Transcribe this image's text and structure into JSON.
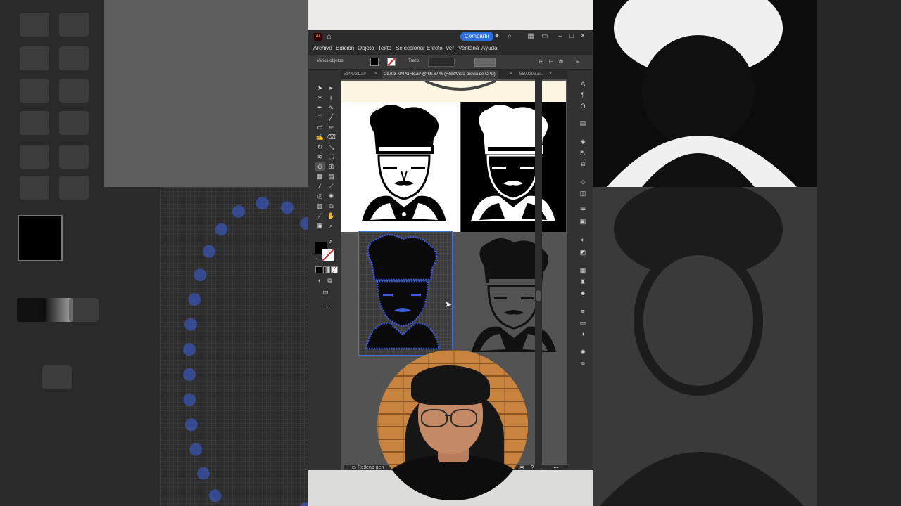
{
  "app": {
    "share_label": "Compartir",
    "logo_text": "Ai"
  },
  "menu": {
    "items": [
      "Archivo",
      "Edición",
      "Objeto",
      "Texto",
      "Seleccionar",
      "Efecto",
      "Ver",
      "Ventana",
      "Ayuda"
    ]
  },
  "control_bar": {
    "selection_label": "Varios objetos",
    "stroke_label": "Trazo"
  },
  "tabs": [
    {
      "label": "5144731.ai*",
      "active": false
    },
    {
      "label": "29703-NXPGFS.ai* @ 66.67 % (RGB/Vista previa de CPU)",
      "active": true
    },
    {
      "label": "5502298.ai...",
      "active": false
    }
  ],
  "status": {
    "text": "Relleno gen"
  },
  "colors": {
    "accent": "#2e6fe0",
    "selection_blue": "#3b5bdb",
    "artboard_cream": "#fbf5e1"
  }
}
